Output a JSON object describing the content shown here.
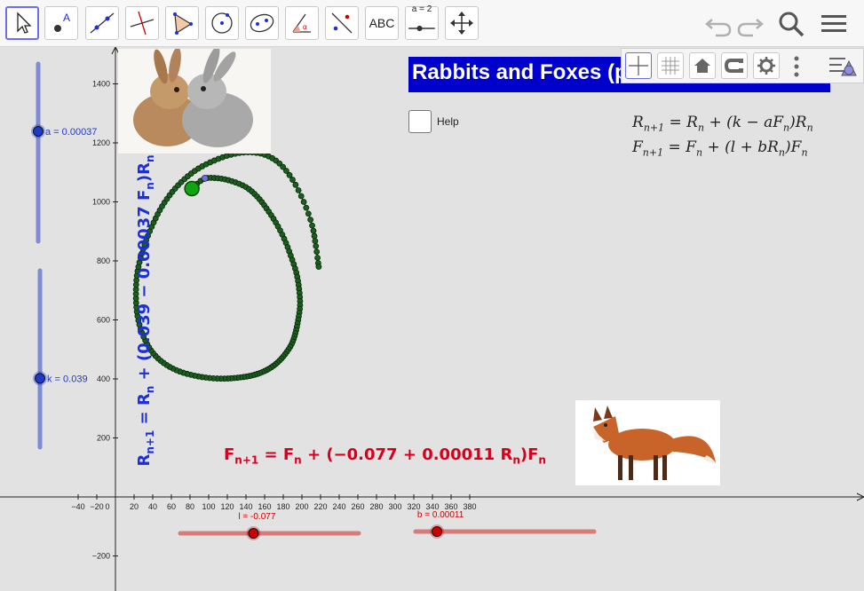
{
  "toolbar": {
    "tools": [
      {
        "name": "move-tool",
        "label": ""
      },
      {
        "name": "point-tool",
        "label": ""
      },
      {
        "name": "line-tool",
        "label": ""
      },
      {
        "name": "perpendicular-line-tool",
        "label": ""
      },
      {
        "name": "polygon-tool",
        "label": ""
      },
      {
        "name": "circle-tool",
        "label": ""
      },
      {
        "name": "ellipse-tool",
        "label": ""
      },
      {
        "name": "angle-tool",
        "label": ""
      },
      {
        "name": "reflect-tool",
        "label": ""
      },
      {
        "name": "text-tool",
        "label": "ABC"
      },
      {
        "name": "slider-tool",
        "label": "a = 2"
      },
      {
        "name": "move-graphics-tool",
        "label": ""
      }
    ],
    "right_icons": [
      "undo-icon",
      "redo-icon",
      "search-icon",
      "menu-icon"
    ]
  },
  "stylebar": {
    "buttons": [
      "axes-toggle",
      "grid-toggle",
      "home-view",
      "label-style",
      "settings",
      "more-menu",
      "style-bar-toggle"
    ]
  },
  "title": "Rabbits and Foxes (p",
  "help": {
    "label": "Help",
    "checked": false
  },
  "equations": {
    "r_line": {
      "lhs_base": "R",
      "lhs_sub": "n+1",
      "rhs": " = R",
      "rhs_sub": "n",
      "rest": " + (k − aF",
      "rest_sub": "n",
      "end": ")R",
      "end_sub": "n"
    },
    "f_line": {
      "lhs_base": "F",
      "lhs_sub": "n+1",
      "rhs": " = F",
      "rhs_sub": "n",
      "rest": " + (l + bR",
      "rest_sub": "n",
      "end": ")F",
      "end_sub": "n"
    }
  },
  "sliders": {
    "a": {
      "label": "a = 0.00037",
      "value": 0.00037,
      "min": 0,
      "max": 0.001,
      "position": 0.62
    },
    "k": {
      "label": "k = 0.039",
      "value": 0.039,
      "min": 0,
      "max": 0.2,
      "position": 0.39
    },
    "l": {
      "label": "l = -0.077",
      "value": -0.077,
      "position": 0.41
    },
    "b": {
      "label": "b = 0.00011",
      "value": 0.00011,
      "position": 0.12
    }
  },
  "formula_r": {
    "text": "R",
    "sub1": "n+1",
    "mid": " = R",
    "sub2": "n",
    "rest": " + (0.039 − 0.00037 F",
    "sub3": "n",
    "end": ")R",
    "sub4": "n"
  },
  "formula_f": {
    "text": "F",
    "sub1": "n+1",
    "mid": " = F",
    "sub2": "n",
    "rest": " + (−0.077 + 0.00011 R",
    "sub3": "n",
    "end": ")F",
    "sub4": "n"
  },
  "axes": {
    "x_ticks": [
      -40,
      -20,
      0,
      20,
      40,
      60,
      80,
      100,
      120,
      140,
      160,
      180,
      200,
      220,
      240,
      260,
      280,
      300,
      320,
      340,
      360,
      380
    ],
    "y_ticks": [
      1400,
      1200,
      1000,
      800,
      600,
      400,
      200,
      -200
    ],
    "x_range": [
      -58,
      400
    ],
    "y_range": [
      -310,
      1530
    ]
  },
  "chart_data": {
    "type": "scatter",
    "title": "",
    "xlabel": "",
    "ylabel": "",
    "series": [
      {
        "x": [
          82,
          95,
          110,
          125,
          140,
          152,
          162,
          172,
          181,
          188,
          194,
          197,
          198,
          196,
          193,
          189,
          182,
          174,
          165,
          155,
          144,
          131,
          117,
          101,
          85,
          69,
          55,
          43,
          34,
          27,
          23,
          22,
          23,
          27,
          33,
          41,
          50,
          61,
          74,
          89,
          106,
          124,
          142,
          160,
          176,
          190,
          202,
          211,
          215,
          218
        ],
        "y": [
          1045,
          1078,
          1080,
          1070,
          1050,
          1018,
          978,
          930,
          875,
          818,
          760,
          705,
          650,
          600,
          555,
          518,
          484,
          456,
          435,
          420,
          410,
          404,
          401,
          403,
          411,
          425,
          447,
          478,
          518,
          570,
          628,
          688,
          750,
          810,
          870,
          930,
          985,
          1034,
          1077,
          1113,
          1140,
          1160,
          1168,
          1160,
          1130,
          1075,
          1000,
          920,
          850,
          780
        ]
      }
    ],
    "start_point": {
      "x": 82,
      "y": 1045
    },
    "blue_point": {
      "x": 96,
      "y": 1080
    },
    "xlim": [
      -58,
      400
    ],
    "ylim": [
      -310,
      1530
    ]
  },
  "colors": {
    "title_bg": "#0000cc",
    "slider_blue": "#1f39c9",
    "slider_red": "#cc0000",
    "orbit": "#1b5e20",
    "orbit_line": "#111111"
  }
}
